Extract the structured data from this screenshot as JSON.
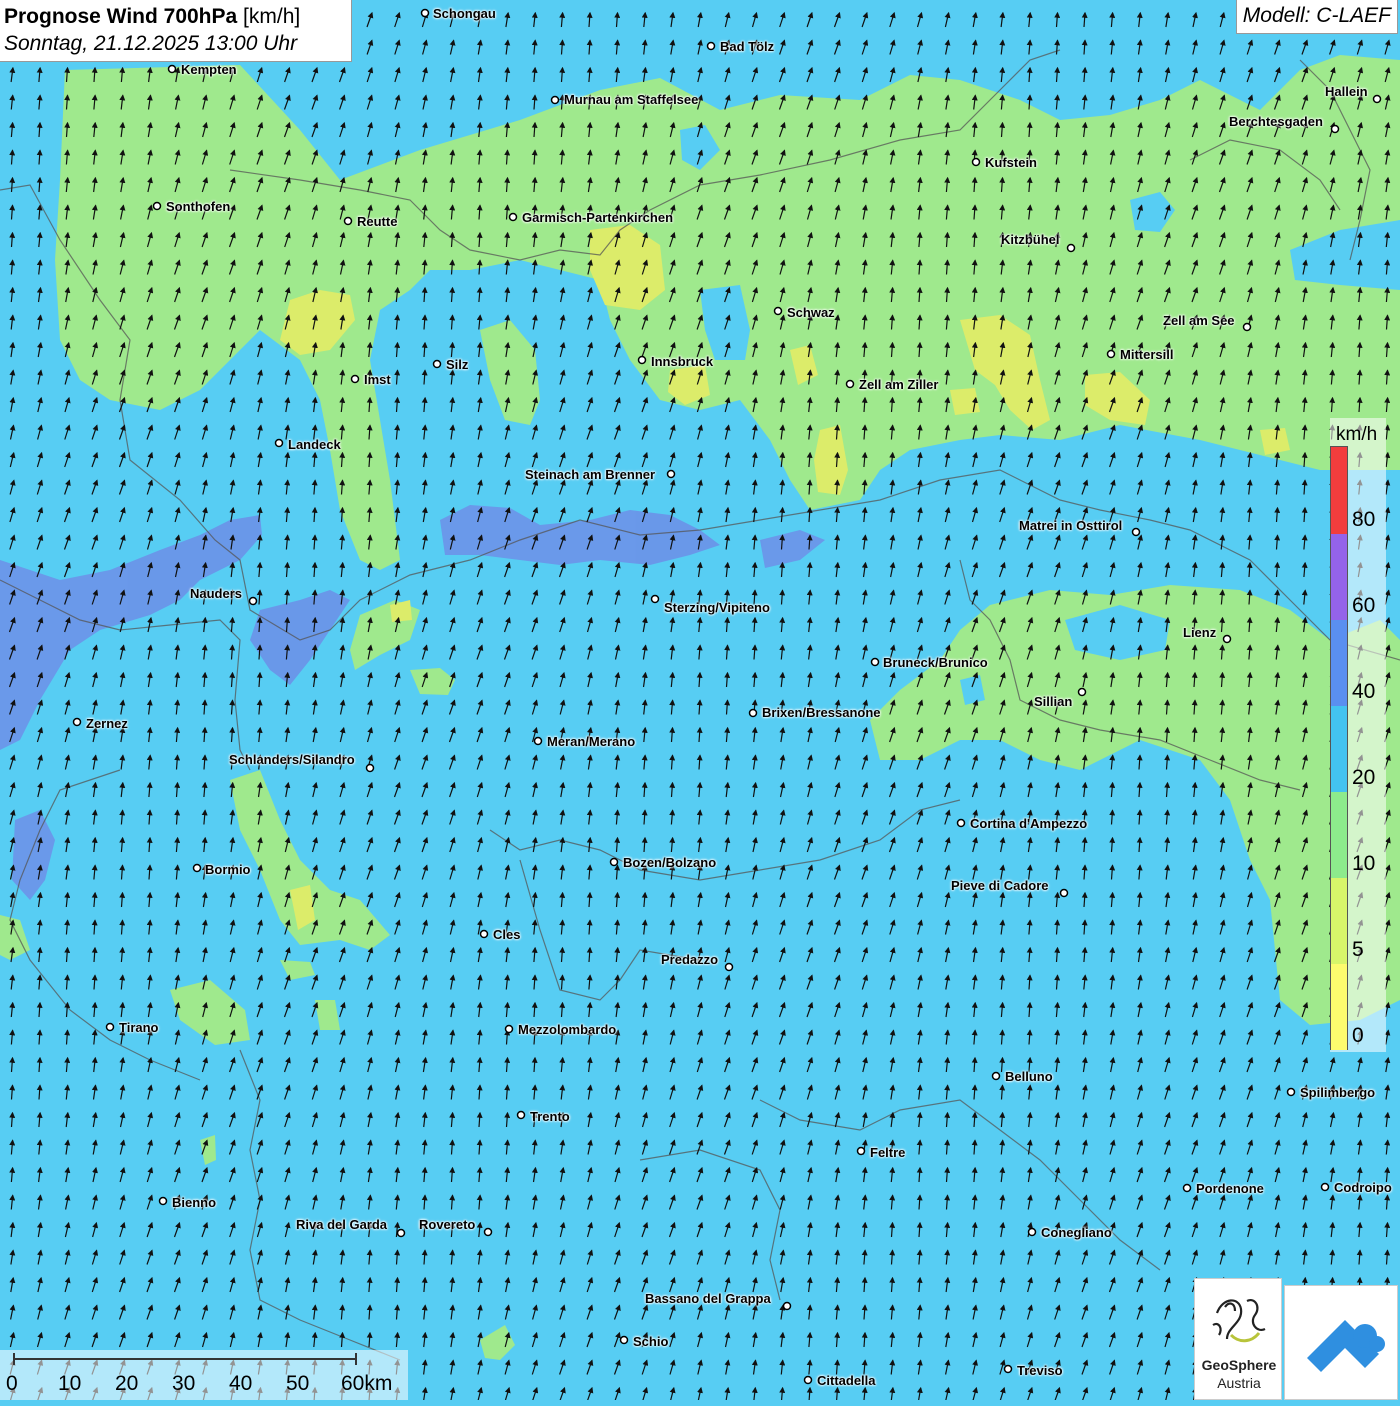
{
  "header": {
    "title": "Prognose Wind 700hPa",
    "unit": "[km/h]",
    "datetime": "Sonntag, 21.12.2025 13:00 Uhr",
    "model": "Modell: C-LAEF"
  },
  "legend": {
    "unit": "km/h",
    "ticks": [
      "0",
      "5",
      "10",
      "20",
      "40",
      "60",
      "80"
    ],
    "colors": [
      "#fdfb6e",
      "#d8f56a",
      "#8deb8c",
      "#43c3f0",
      "#5a8ff0",
      "#9463ea",
      "#f23d3d"
    ]
  },
  "scalebar": {
    "labels": [
      "0",
      "10",
      "20",
      "30",
      "40",
      "50",
      "60km"
    ]
  },
  "logos": {
    "geosphere_name": "GeoSphere",
    "geosphere_sub": "Austria"
  },
  "colors": {
    "background_wind_10_20": "#57cdf3",
    "wind_5_10": "#9fe98d",
    "wind_0_5": "#dcec6a",
    "wind_20_40": "#6d8fe8"
  },
  "wind_direction": "arrows pointing mostly north-northwest",
  "cities": [
    "Schongau",
    "Bad Tölz",
    "Kempten",
    "Murnau am Staffelsee",
    "Hallein",
    "Berchtesgaden",
    "Kufstein",
    "Sonthofen",
    "Reutte",
    "Garmisch-Partenkirchen",
    "Kitzbühel",
    "Schwaz",
    "Zell am See",
    "Mittersill",
    "Silz",
    "Innsbruck",
    "Imst",
    "Zell am Ziller",
    "Landeck",
    "Steinach am Brenner",
    "Matrei in Osttirol",
    "Nauders",
    "Sterzing/Vipiteno",
    "Lienz",
    "Bruneck/Brunico",
    "Sillian",
    "Zernez",
    "Brixen/Bressanone",
    "Meran/Merano",
    "Schlanders/Silandro",
    "Cortina d'Ampezzo",
    "Bormio",
    "Bozen/Bolzano",
    "Pieve di Cadore",
    "Cles",
    "Predazzo",
    "Tirano",
    "Mezzolombardo",
    "Belluno",
    "Spilimbergo",
    "Trento",
    "Feltre",
    "Bienno",
    "Pordenone",
    "Codroipo",
    "Riva del Garda",
    "Rovereto",
    "Conegliano",
    "Bassano del Grappa",
    "Schio",
    "Treviso",
    "Cittadella"
  ]
}
